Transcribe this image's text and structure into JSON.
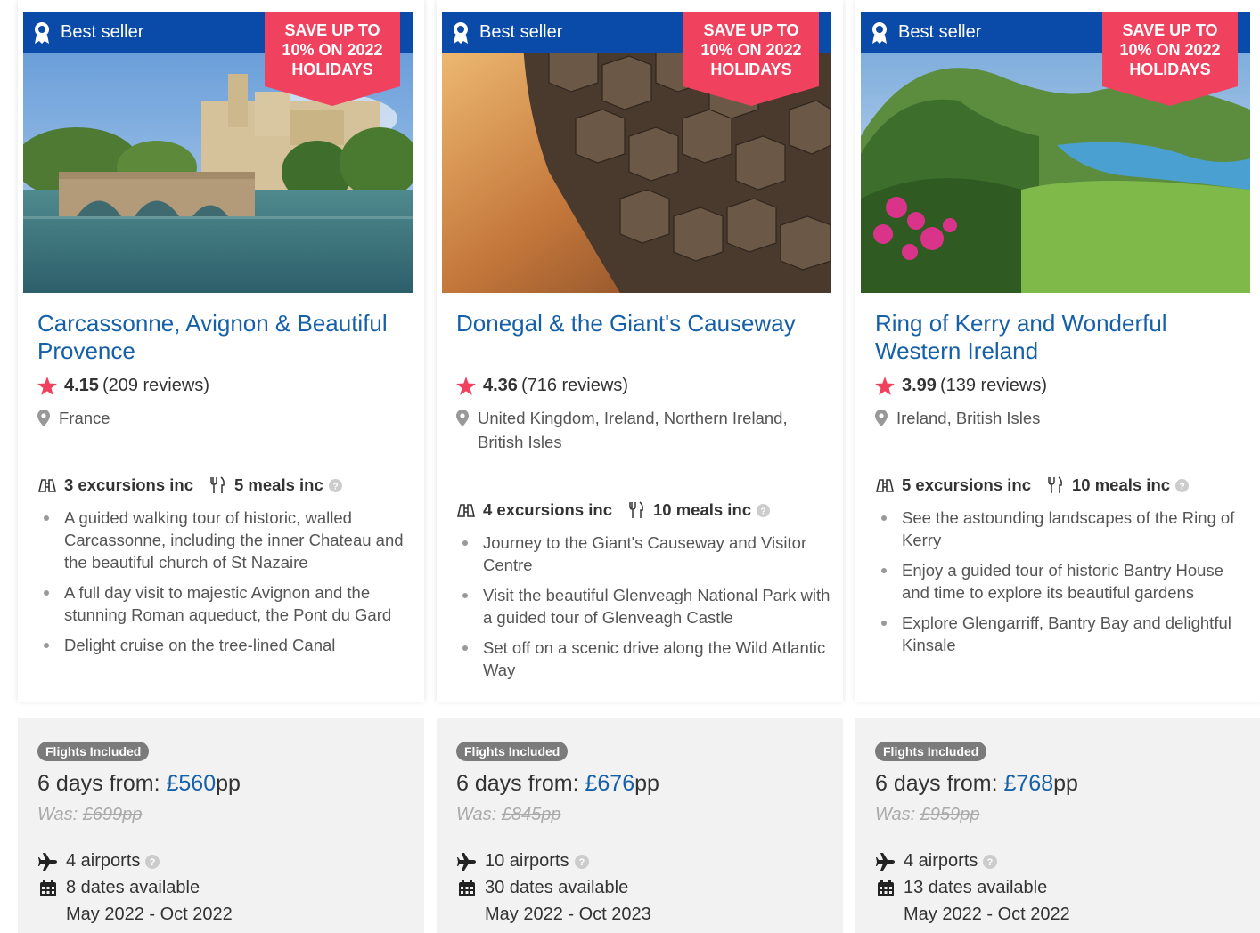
{
  "cards": [
    {
      "badge": "Best seller",
      "promo_lines": [
        "SAVE UP TO",
        "10% ON 2022",
        "HOLIDAYS"
      ],
      "image_subject": "avignon-bridge-photo",
      "title": "Carcassonne, Avignon & Beautiful Provence",
      "rating": "4.15",
      "reviews": "(209 reviews)",
      "location": "France",
      "excursions": "3 excursions inc",
      "meals": "5 meals inc",
      "highlights": [
        "A guided walking tour of historic, walled Carcassonne, including the inner Chateau and the beautiful church of St Nazaire",
        "A full day visit to majestic Avignon and the stunning Roman aqueduct, the Pont du Gard",
        "Delight cruise on the tree-lined Canal"
      ],
      "flights_badge": "Flights Included",
      "from_prefix": "6 days from: ",
      "price": "£560",
      "price_suffix": "pp",
      "was_prefix": "Was: ",
      "was_price": "£699pp",
      "airports": "4 airports",
      "dates": "8 dates available",
      "date_range": "May 2022 - Oct 2022"
    },
    {
      "badge": "Best seller",
      "promo_lines": [
        "SAVE UP TO",
        "10% ON 2022",
        "HOLIDAYS"
      ],
      "image_subject": "giants-causeway-photo",
      "title": "Donegal & the Giant's Causeway",
      "rating": "4.36",
      "reviews": "(716 reviews)",
      "location": "United Kingdom, Ireland, Northern Ireland, British Isles",
      "excursions": "4 excursions inc",
      "meals": "10 meals inc",
      "highlights": [
        "Journey to the Giant's Causeway and Visitor Centre",
        "Visit the beautiful Glenveagh National Park with a guided tour of Glenveagh Castle",
        "Set off on a scenic drive along the Wild Atlantic Way"
      ],
      "flights_badge": "Flights Included",
      "from_prefix": "6 days from: ",
      "price": "£676",
      "price_suffix": "pp",
      "was_prefix": "Was: ",
      "was_price": "£845pp",
      "airports": "10 airports",
      "dates": "30 dates available",
      "date_range": "May 2022 - Oct 2023"
    },
    {
      "badge": "Best seller",
      "promo_lines": [
        "SAVE UP TO",
        "10% ON 2022",
        "HOLIDAYS"
      ],
      "image_subject": "ring-of-kerry-photo",
      "title": "Ring of Kerry and Wonderful Western Ireland",
      "rating": "3.99",
      "reviews": "(139 reviews)",
      "location": "Ireland, British Isles",
      "excursions": "5 excursions inc",
      "meals": "10 meals inc",
      "highlights": [
        "See the astounding landscapes of the Ring of Kerry",
        "Enjoy a guided tour of historic Bantry House and time to explore its beautiful gardens",
        "Explore Glengarriff, Bantry Bay and delightful Kinsale"
      ],
      "flights_badge": "Flights Included",
      "from_prefix": "6 days from: ",
      "price": "£768",
      "price_suffix": "pp",
      "was_prefix": "Was: ",
      "was_price": "£959pp",
      "airports": "4 airports",
      "dates": "13 dates available",
      "date_range": "May 2022 - Oct 2022"
    }
  ],
  "colors": {
    "brand_blue": "#0a4aa8",
    "link_blue": "#1560a8",
    "promo_pink": "#f0415e",
    "star_pink": "#f0415e",
    "panel_grey": "#f2f2f2"
  }
}
